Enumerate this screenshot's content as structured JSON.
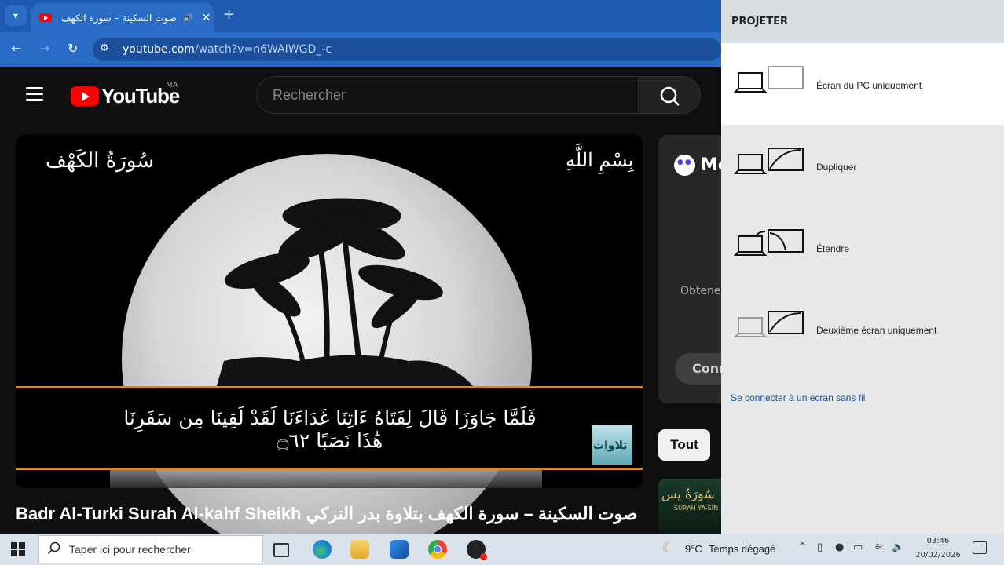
{
  "browser": {
    "tab_title": "صوت السكينة – سورة الكهف",
    "url_host": "youtube.com",
    "url_path": "/watch?v=n6WAIWGD_-c"
  },
  "youtube": {
    "wordmark": "YouTube",
    "region": "MA",
    "search_placeholder": "Rechercher"
  },
  "video": {
    "overlay_surah": "سُورَةُ الكَهْف",
    "overlay_basmala": "بِسْمِ اللَّهِ",
    "verse": "فَلَمَّا جَاوَزَا قَالَ لِفَتَاهُ ءَاتِنَا غَدَاءَنَا لَقَدْ لَقِينَا مِن سَفَرِنَا هَٰذَا نَصَبًا ۝٦٢",
    "channel_badge": "تلاوات",
    "title": "صوت السكينة – سورة الكهف بتلاوة بدر التركي Badr Al-Turki Surah Al-kahf Sheikh"
  },
  "sidebar": {
    "card_title": "Mo",
    "card_text": "Obtenez",
    "card_button": "Conn",
    "chip_all": "Tout",
    "thumb_title": "سُورَةُ يس",
    "thumb_sub": "SURAH YA-SIN"
  },
  "project_panel": {
    "title": "PROJETER",
    "options": [
      {
        "label": "Écran du PC uniquement",
        "selected": true
      },
      {
        "label": "Dupliquer",
        "selected": false
      },
      {
        "label": "Étendre",
        "selected": false
      },
      {
        "label": "Deuxième écran uniquement",
        "selected": false
      }
    ],
    "wireless_link": "Se connecter à un écran sans fil"
  },
  "taskbar": {
    "search_placeholder": "Taper ici pour rechercher",
    "weather_temp": "9°C",
    "weather_desc": "Temps dégagé",
    "time": "03:46",
    "date": "20/02/2026",
    "apps": [
      "task-view-icon",
      "edge-icon",
      "file-explorer-icon",
      "outlook-icon",
      "chrome-icon",
      "obs-icon"
    ]
  },
  "colors": {
    "chrome_blue": "#1e5bb0",
    "yt_red": "#ff0000",
    "panel_bg": "#e6e8ea",
    "verse_border": "#d08a3a"
  }
}
